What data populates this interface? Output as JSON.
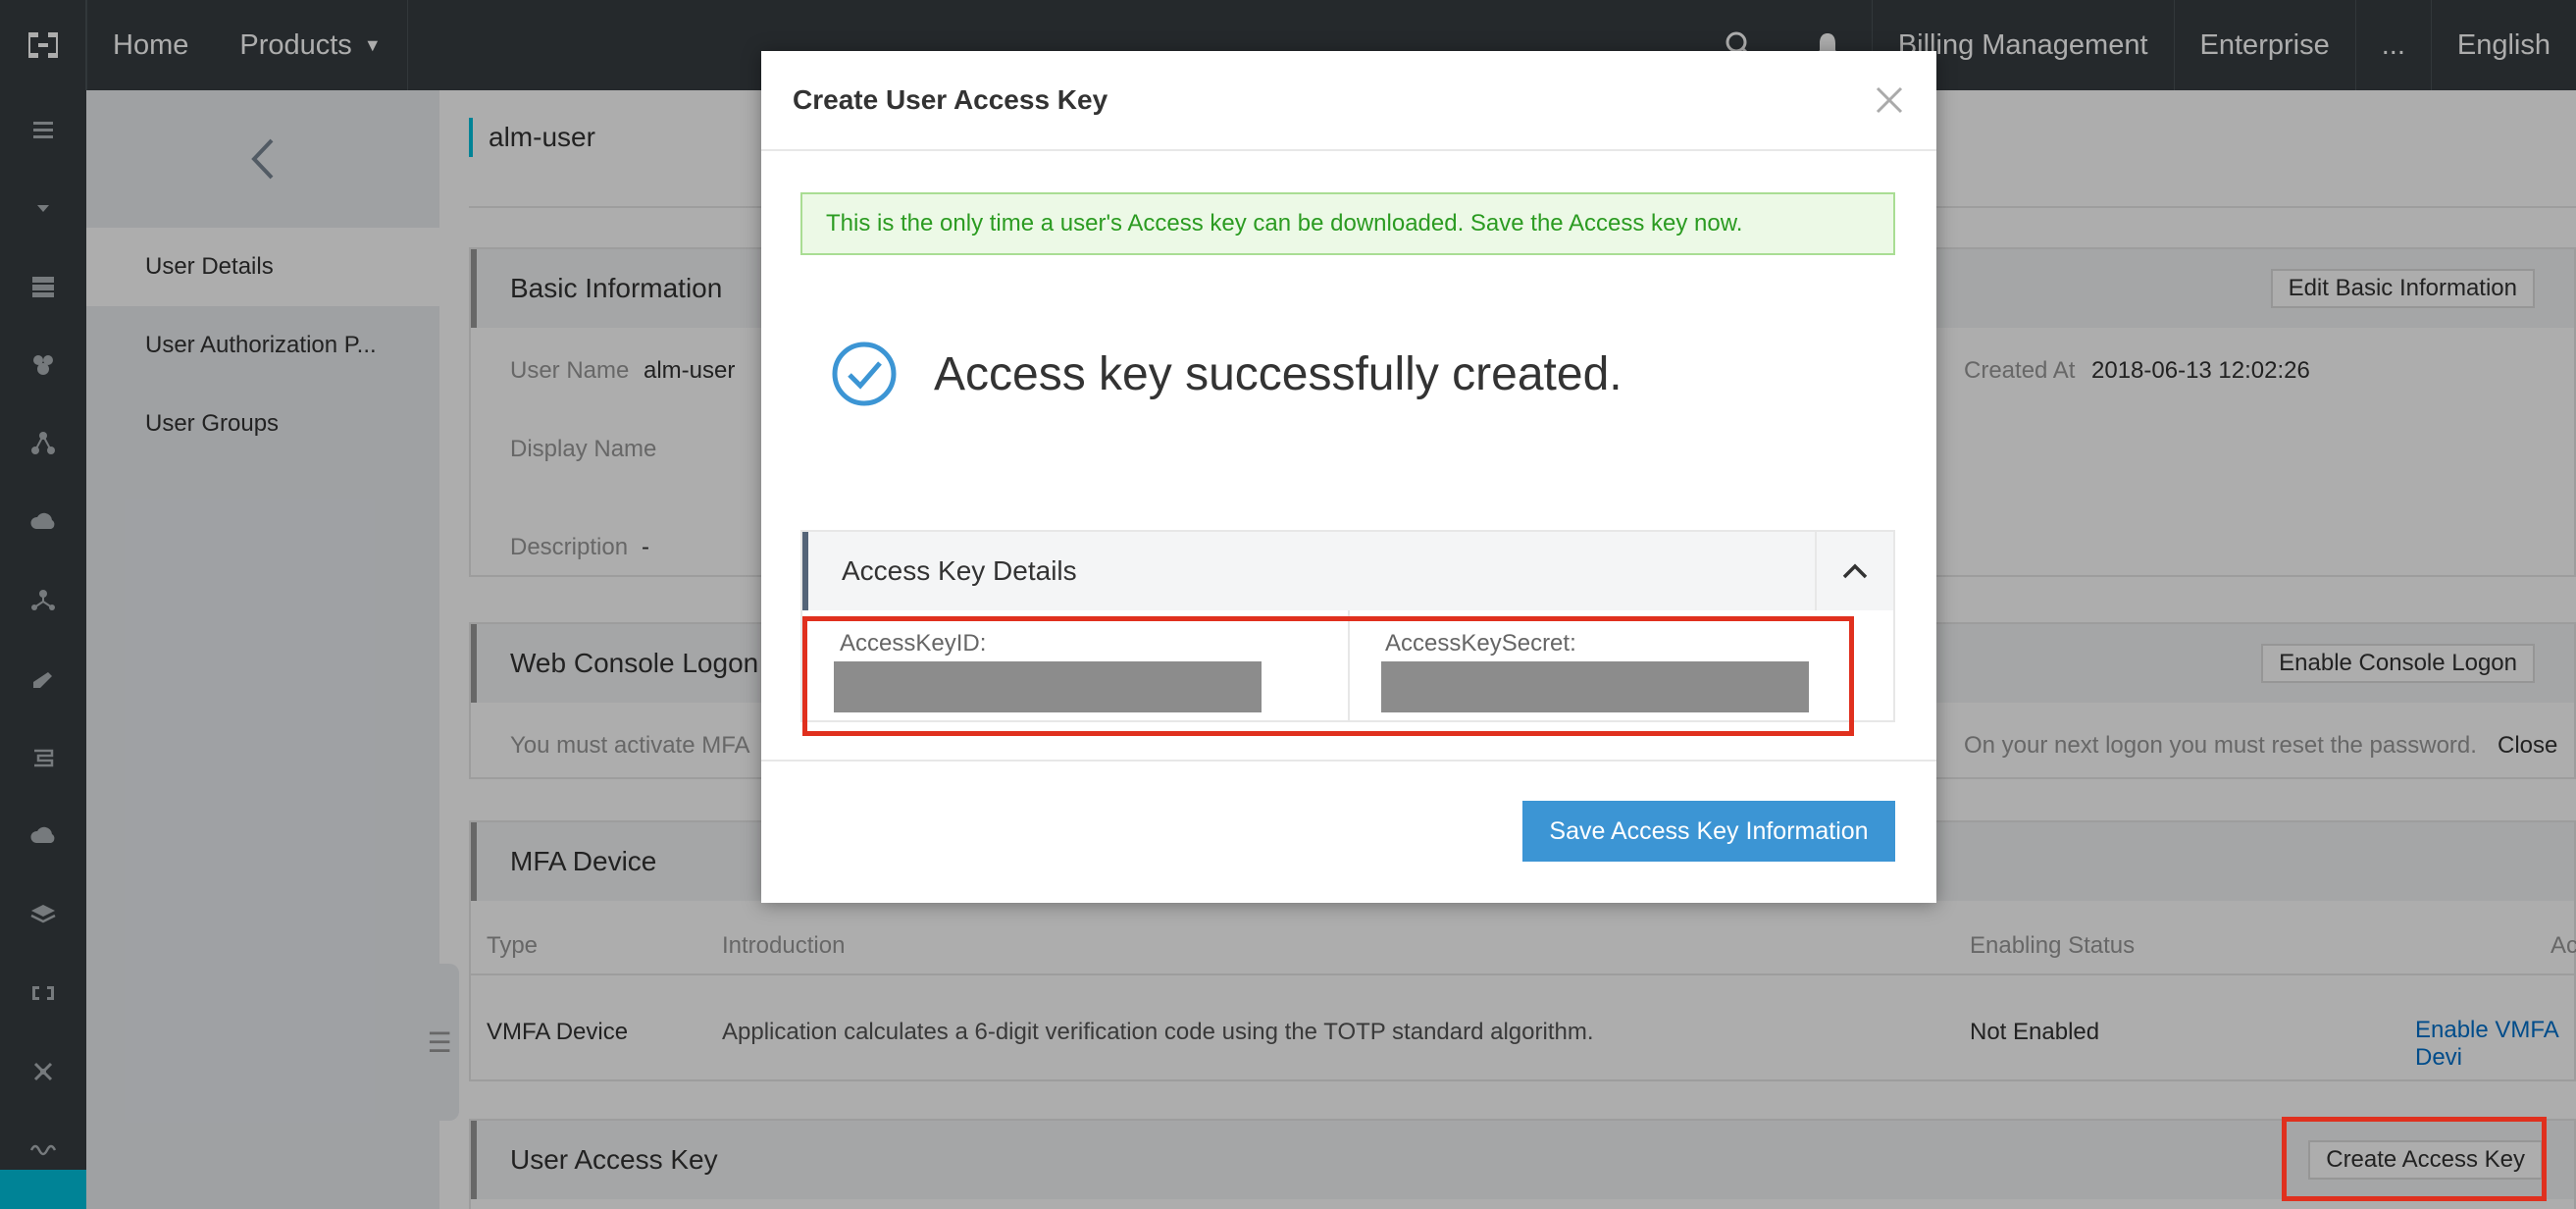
{
  "topbar": {
    "home": "Home",
    "products": "Products",
    "billing": "Billing Management",
    "enterprise": "Enterprise",
    "more": "...",
    "language": "English"
  },
  "rail": {
    "icons": [
      "menu-icon",
      "collapse-icon",
      "server-icon",
      "cluster-icon",
      "network-icon",
      "cloud-icon",
      "share-icon",
      "pen-icon",
      "flow-icon",
      "cloud-upload-icon",
      "layers-icon",
      "logo-icon",
      "cross-icon",
      "wave-icon"
    ]
  },
  "subnav": {
    "items": [
      "User Details",
      "User Authorization P...",
      "User Groups"
    ]
  },
  "page": {
    "title": "alm-user"
  },
  "basic_info": {
    "title": "Basic Information",
    "edit_button": "Edit Basic Information",
    "user_name_label": "User Name",
    "user_name_value": "alm-user",
    "display_name_label": "Display Name",
    "description_label": "Description",
    "description_value": "-",
    "created_at_label": "Created At",
    "created_at_value": "2018-06-13 12:02:26"
  },
  "console_logon": {
    "title": "Web Console Logon",
    "enable_button": "Enable Console Logon",
    "mfa_note": "You must activate MFA",
    "reset_note": "On your next logon you must reset the password.",
    "close_label": "Close"
  },
  "mfa": {
    "title": "MFA Device",
    "columns": [
      "Type",
      "Introduction",
      "Enabling Status",
      "Ac"
    ],
    "row": {
      "type": "VMFA Device",
      "introduction": "Application calculates a 6-digit verification code using the TOTP standard algorithm.",
      "status": "Not Enabled",
      "action": "Enable VMFA Devi"
    }
  },
  "access_key": {
    "title": "User Access Key",
    "create_button": "Create Access Key"
  },
  "modal": {
    "title": "Create User Access Key",
    "alert": "This is the only time a user's Access key can be downloaded. Save the Access key now.",
    "success": "Access key successfully created.",
    "details_title": "Access Key Details",
    "key_id_label": "AccessKeyID:",
    "key_secret_label": "AccessKeySecret:",
    "save_button": "Save Access Key Information"
  },
  "colors": {
    "topbar": "#373d41",
    "accent": "#00c1de",
    "primary_button": "#3c95d4",
    "highlight": "#e0301e",
    "success_green": "#2b9b21"
  }
}
